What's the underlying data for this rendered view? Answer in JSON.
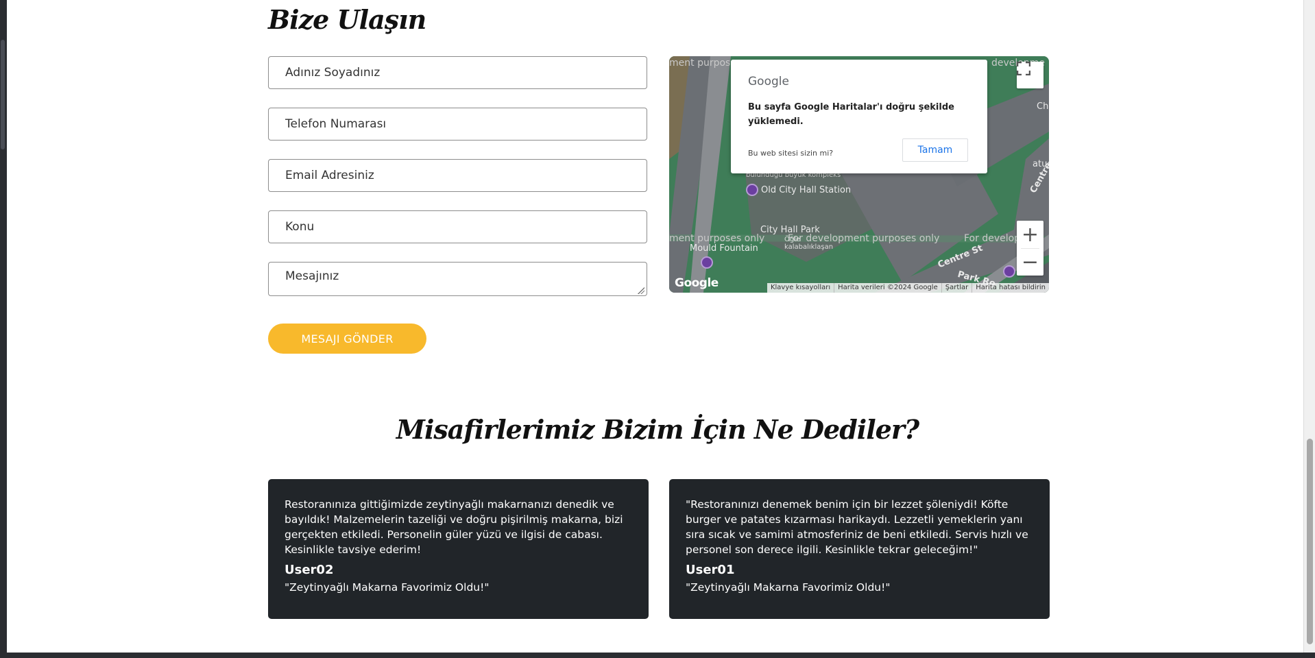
{
  "contact": {
    "title": "Bize Ulaşın",
    "fields": {
      "name_placeholder": "Adınız Soyadınız",
      "phone_placeholder": "Telefon Numarası",
      "email_placeholder": "Email Adresiniz",
      "subject_placeholder": "Konu",
      "message_placeholder": "Mesajınız"
    },
    "send_label": "MESAJI GÖNDER"
  },
  "map": {
    "dialog": {
      "brand": "Google",
      "message": "Bu sayfa Google Haritalar'ı doğru şekilde yüklemedi.",
      "owner_question": "Bu web sitesi sizin mi?",
      "ok_label": "Tamam"
    },
    "labels": {
      "dev_only_1": "ment purposes",
      "dev_only_2": "ment purposes only",
      "dev_only_3": "For development purposes only",
      "dev_only_4": "For develop",
      "dev_only_5": "developme",
      "place_1": "Old City Hall Station",
      "place_2": "City Hall Park",
      "place_3": "Mould Fountain",
      "place_4": "Öğle",
      "place_5": "kalabalıklaşan",
      "place_6": "bulunduğu büyük kompleks",
      "place_7": "Cha",
      "place_8": "atue",
      "street_1": "Centre St",
      "street_2": "Park Ro",
      "street_3": "Centre"
    },
    "logo": "Google",
    "attribution": {
      "keyboard": "Klavye kısayolları",
      "data": "Harita verileri ©2024 Google",
      "terms": "Şartlar",
      "report": "Harita hatası bildirin"
    },
    "zoom_in": "+",
    "zoom_out": "−"
  },
  "reviews": {
    "title": "Misafirlerimiz Bizim İçin Ne Dediler?",
    "items": [
      {
        "text": "Restoranınıza gittiğimizde zeytinyağlı makarnanızı denedik ve bayıldık! Malzemelerin tazeliği ve doğru pişirilmiş makarna, bizi gerçekten etkiledi. Personelin güler yüzü ve ilgisi de cabası. Kesinlikle tavsiye ederim!",
        "user": "User02",
        "heading": "\"Zeytinyağlı Makarna Favorimiz Oldu!\""
      },
      {
        "text": "\"Restoranınızı denemek benim için bir lezzet şöleniydi! Köfte burger ve patates kızarması harikaydı. Lezzetli yemeklerin yanı sıra sıcak ve samimi atmosferiniz de beni etkiledi. Servis hızlı ve personel son derece ilgili. Kesinlikle tekrar geleceğim!\"",
        "user": "User01",
        "heading": "\"Zeytinyağlı Makarna Favorimiz Oldu!\""
      }
    ]
  },
  "colors": {
    "accent": "#f8b92c",
    "card_bg": "#212529",
    "map_green": "#3f7d58"
  }
}
